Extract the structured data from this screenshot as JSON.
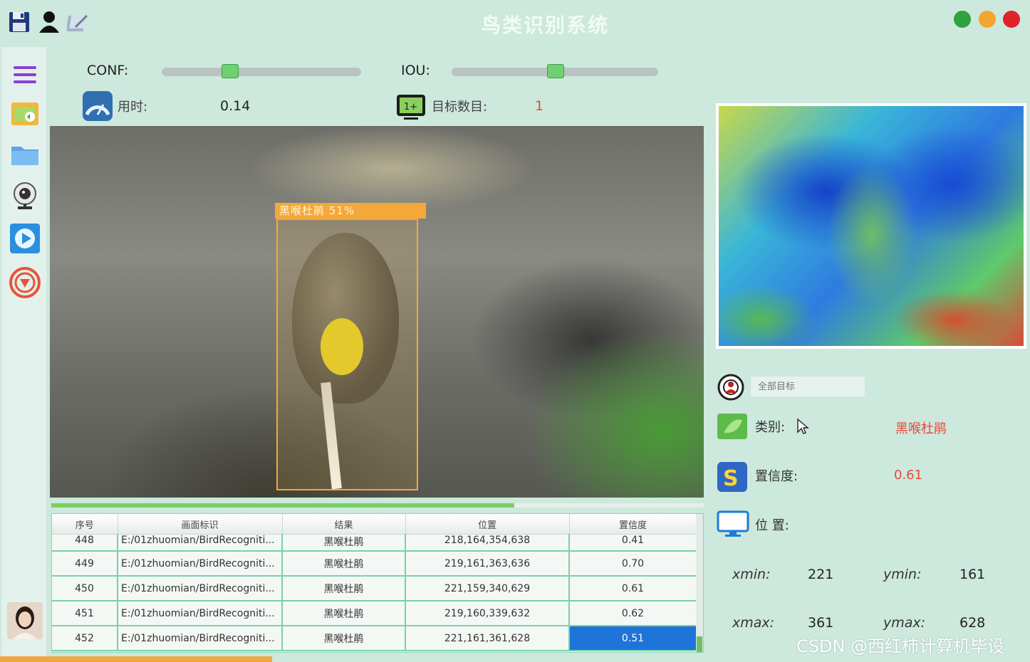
{
  "window": {
    "title": "鸟类识别系统",
    "controls": {
      "green": "#2ea23c",
      "yellow": "#f3a52f",
      "red": "#e0232b"
    }
  },
  "toolbar": {
    "icons": [
      "save-icon",
      "user-icon",
      "edit-icon"
    ]
  },
  "sidebar": {
    "items": [
      "menu-icon",
      "image-folder-icon",
      "folder-icon",
      "webcam-icon",
      "video-play-icon",
      "stop-icon"
    ],
    "avatar": "avatar"
  },
  "controls": {
    "conf_label": "CONF:",
    "conf_value": 0.34,
    "iou_label": "IOU:",
    "iou_value": 0.5,
    "time_label": "用时:",
    "time_value": "0.14",
    "count_label": "目标数目:",
    "count_value": "1"
  },
  "detection": {
    "box_label": "黑喉杜鹃 51%"
  },
  "progress": {
    "value": 0.71
  },
  "table": {
    "headers": [
      "序号",
      "画面标识",
      "结果",
      "位置",
      "置信度"
    ],
    "rows": [
      [
        "448",
        "E:/01zhuomian/BirdRecogniti...",
        "黑喉杜鹃",
        "218,164,354,638",
        "0.41"
      ],
      [
        "449",
        "E:/01zhuomian/BirdRecogniti...",
        "黑喉杜鹃",
        "219,161,363,636",
        "0.70"
      ],
      [
        "450",
        "E:/01zhuomian/BirdRecogniti...",
        "黑喉杜鹃",
        "221,159,340,629",
        "0.61"
      ],
      [
        "451",
        "E:/01zhuomian/BirdRecogniti...",
        "黑喉杜鹃",
        "219,160,339,632",
        "0.62"
      ],
      [
        "452",
        "E:/01zhuomian/BirdRecogniti...",
        "黑喉杜鹃",
        "221,161,361,628",
        "0.51"
      ]
    ],
    "selected_row": 4,
    "selected_col": 4
  },
  "details": {
    "search_placeholder": "全部目标",
    "class_label": "类别:",
    "class_value": "黑喉杜鹃",
    "conf_label": "置信度:",
    "conf_value": "0.61",
    "pos_label": "位 置:",
    "xmin_label": "xmin:",
    "xmin_value": "221",
    "ymin_label": "ymin:",
    "ymin_value": "161",
    "xmax_label": "xmax:",
    "xmax_value": "361",
    "ymax_label": "ymax:",
    "ymax_value": "628"
  },
  "watermark": "CSDN @西红柿计算机毕设"
}
